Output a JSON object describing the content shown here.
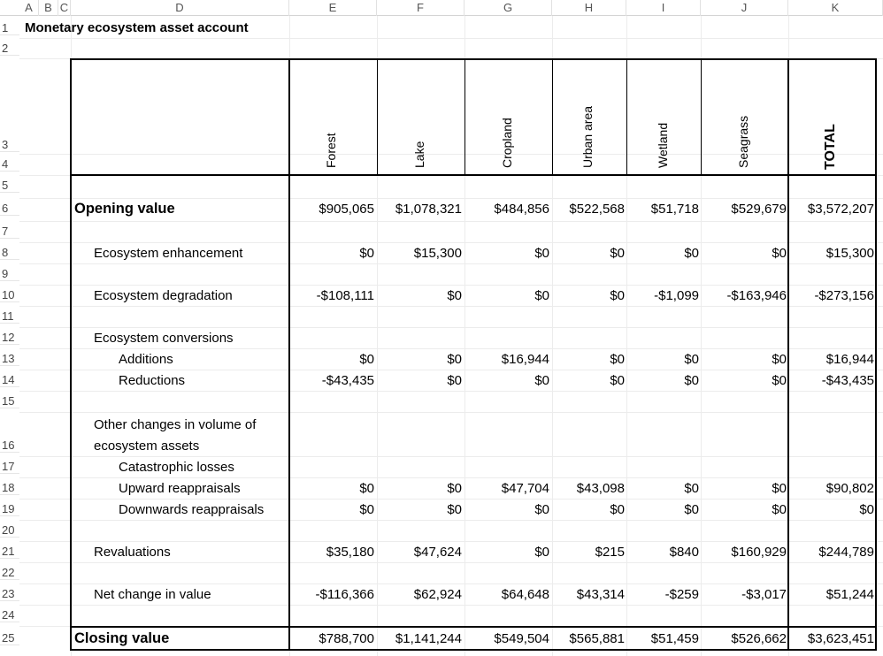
{
  "sheet": {
    "col_headers": [
      "A",
      "B",
      "C",
      "D",
      "E",
      "F",
      "G",
      "H",
      "I",
      "J",
      "K"
    ],
    "row_headers": [
      "1",
      "2",
      "3",
      "4",
      "5",
      "6",
      "7",
      "8",
      "9",
      "10",
      "11",
      "12",
      "13",
      "14",
      "15",
      "16",
      "17",
      "18",
      "19",
      "20",
      "21",
      "22",
      "23",
      "24",
      "25"
    ]
  },
  "title": "Monetary ecosystem asset account",
  "columns": [
    "Forest",
    "Lake",
    "Cropland",
    "Urban area",
    "Wetland",
    "Seagrass",
    "TOTAL"
  ],
  "rows": {
    "opening": {
      "label": "Opening value",
      "values": [
        "$905,065",
        "$1,078,321",
        "$484,856",
        "$522,568",
        "$51,718",
        "$529,679",
        "$3,572,207"
      ]
    },
    "enhancement": {
      "label": "Ecosystem enhancement",
      "values": [
        "$0",
        "$15,300",
        "$0",
        "$0",
        "$0",
        "$0",
        "$15,300"
      ]
    },
    "degradation": {
      "label": "Ecosystem degradation",
      "values": [
        "-$108,111",
        "$0",
        "$0",
        "$0",
        "-$1,099",
        "-$163,946",
        "-$273,156"
      ]
    },
    "conversions": {
      "label": "Ecosystem conversions"
    },
    "additions": {
      "label": "Additions",
      "values": [
        "$0",
        "$0",
        "$16,944",
        "$0",
        "$0",
        "$0",
        "$16,944"
      ]
    },
    "reductions": {
      "label": "Reductions",
      "values": [
        "-$43,435",
        "$0",
        "$0",
        "$0",
        "$0",
        "$0",
        "-$43,435"
      ]
    },
    "other_changes": {
      "label_line1": "Other changes in volume of",
      "label_line2": "ecosystem assets"
    },
    "catastrophic": {
      "label": "Catastrophic losses"
    },
    "upward": {
      "label": "Upward reappraisals",
      "values": [
        "$0",
        "$0",
        "$47,704",
        "$43,098",
        "$0",
        "$0",
        "$90,802"
      ]
    },
    "downwards": {
      "label": "Downwards reappraisals",
      "values": [
        "$0",
        "$0",
        "$0",
        "$0",
        "$0",
        "$0",
        "$0"
      ]
    },
    "revaluations": {
      "label": "Revaluations",
      "values": [
        "$35,180",
        "$47,624",
        "$0",
        "$215",
        "$840",
        "$160,929",
        "$244,789"
      ]
    },
    "net_change": {
      "label": "Net change in value",
      "values": [
        "-$116,366",
        "$62,924",
        "$64,648",
        "$43,314",
        "-$259",
        "-$3,017",
        "$51,244"
      ]
    },
    "closing": {
      "label": "Closing value",
      "values": [
        "$788,700",
        "$1,141,244",
        "$549,504",
        "$565,881",
        "$51,459",
        "$526,662",
        "$3,623,451"
      ]
    }
  }
}
